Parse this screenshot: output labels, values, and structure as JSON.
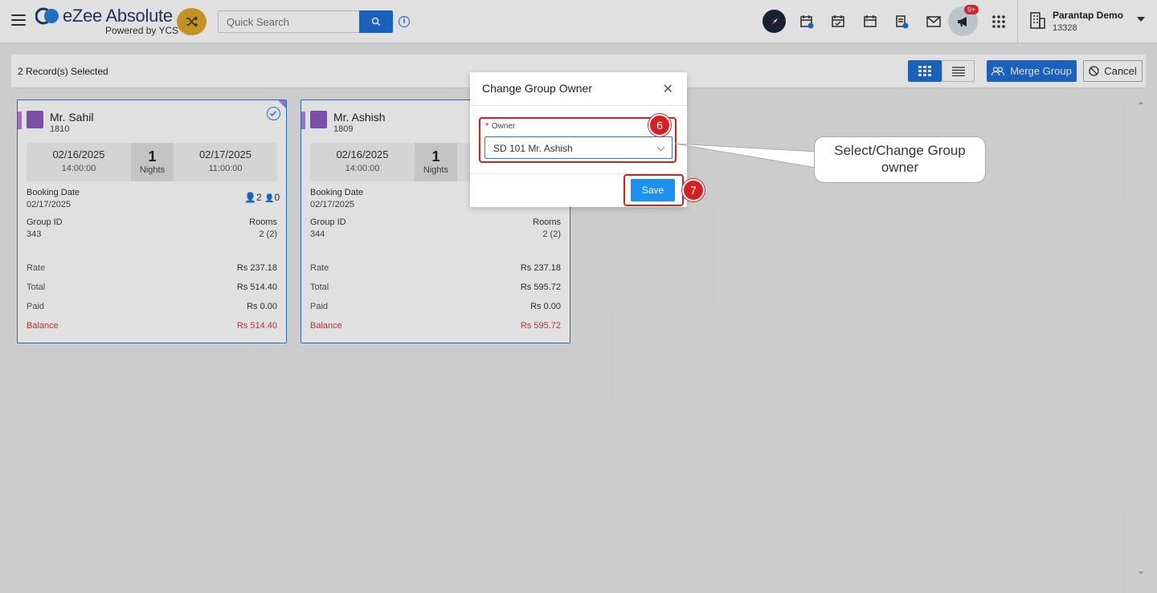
{
  "header": {
    "logo_text": "eZee Absolute",
    "logo_sub": "Powered by YCS",
    "search_placeholder": "Quick Search",
    "notification_badge": "9+",
    "user_name": "Parantap Demo",
    "user_id": "13328"
  },
  "toolbar": {
    "records_selected": "2 Record(s) Selected",
    "merge_group_label": "Merge Group",
    "cancel_label": "Cancel"
  },
  "cards": [
    {
      "name": "Mr. Sahil",
      "number": "1810",
      "checkin_date": "02/16/2025",
      "checkin_time": "14:00:00",
      "nights": "1",
      "nights_label": "Nights",
      "checkout_date": "02/17/2025",
      "checkout_time": "11:00:00",
      "booking_date_label": "Booking Date",
      "booking_date": "02/17/2025",
      "adults": "2",
      "children": "0",
      "group_id_label": "Group ID",
      "group_id": "343",
      "rooms_label": "Rooms",
      "rooms": "2 (2)",
      "rate_label": "Rate",
      "rate": "Rs 237.18",
      "total_label": "Total",
      "total": "Rs 514.40",
      "paid_label": "Paid",
      "paid": "Rs 0.00",
      "balance_label": "Balance",
      "balance": "Rs 514.40"
    },
    {
      "name": "Mr. Ashish",
      "number": "1809",
      "checkin_date": "02/16/2025",
      "checkin_time": "14:00:00",
      "nights": "1",
      "nights_label": "Nights",
      "checkout_date": "",
      "checkout_time": "",
      "booking_date_label": "Booking Date",
      "booking_date": "02/17/2025",
      "group_id_label": "Group ID",
      "group_id": "344",
      "rooms_label": "Rooms",
      "rooms": "2 (2)",
      "rate_label": "Rate",
      "rate": "Rs 237.18",
      "total_label": "Total",
      "total": "Rs 595.72",
      "paid_label": "Paid",
      "paid": "Rs 0.00",
      "balance_label": "Balance",
      "balance": "Rs 595.72"
    }
  ],
  "modal": {
    "title": "Change Group Owner",
    "close_glyph": "✕",
    "owner_label": "Owner",
    "required_mark": "*",
    "owner_value": "SD 101 Mr. Ashish",
    "save_label": "Save"
  },
  "annotations": {
    "step6": "6",
    "step7": "7",
    "callout_line1": "Select/Change Group",
    "callout_line2": "owner"
  },
  "colors": {
    "primary": "#1e6fd9",
    "save": "#1e90f0",
    "balance": "#d43b3b",
    "highlight": "#d42020",
    "accent_purple": "#b57fd9"
  }
}
